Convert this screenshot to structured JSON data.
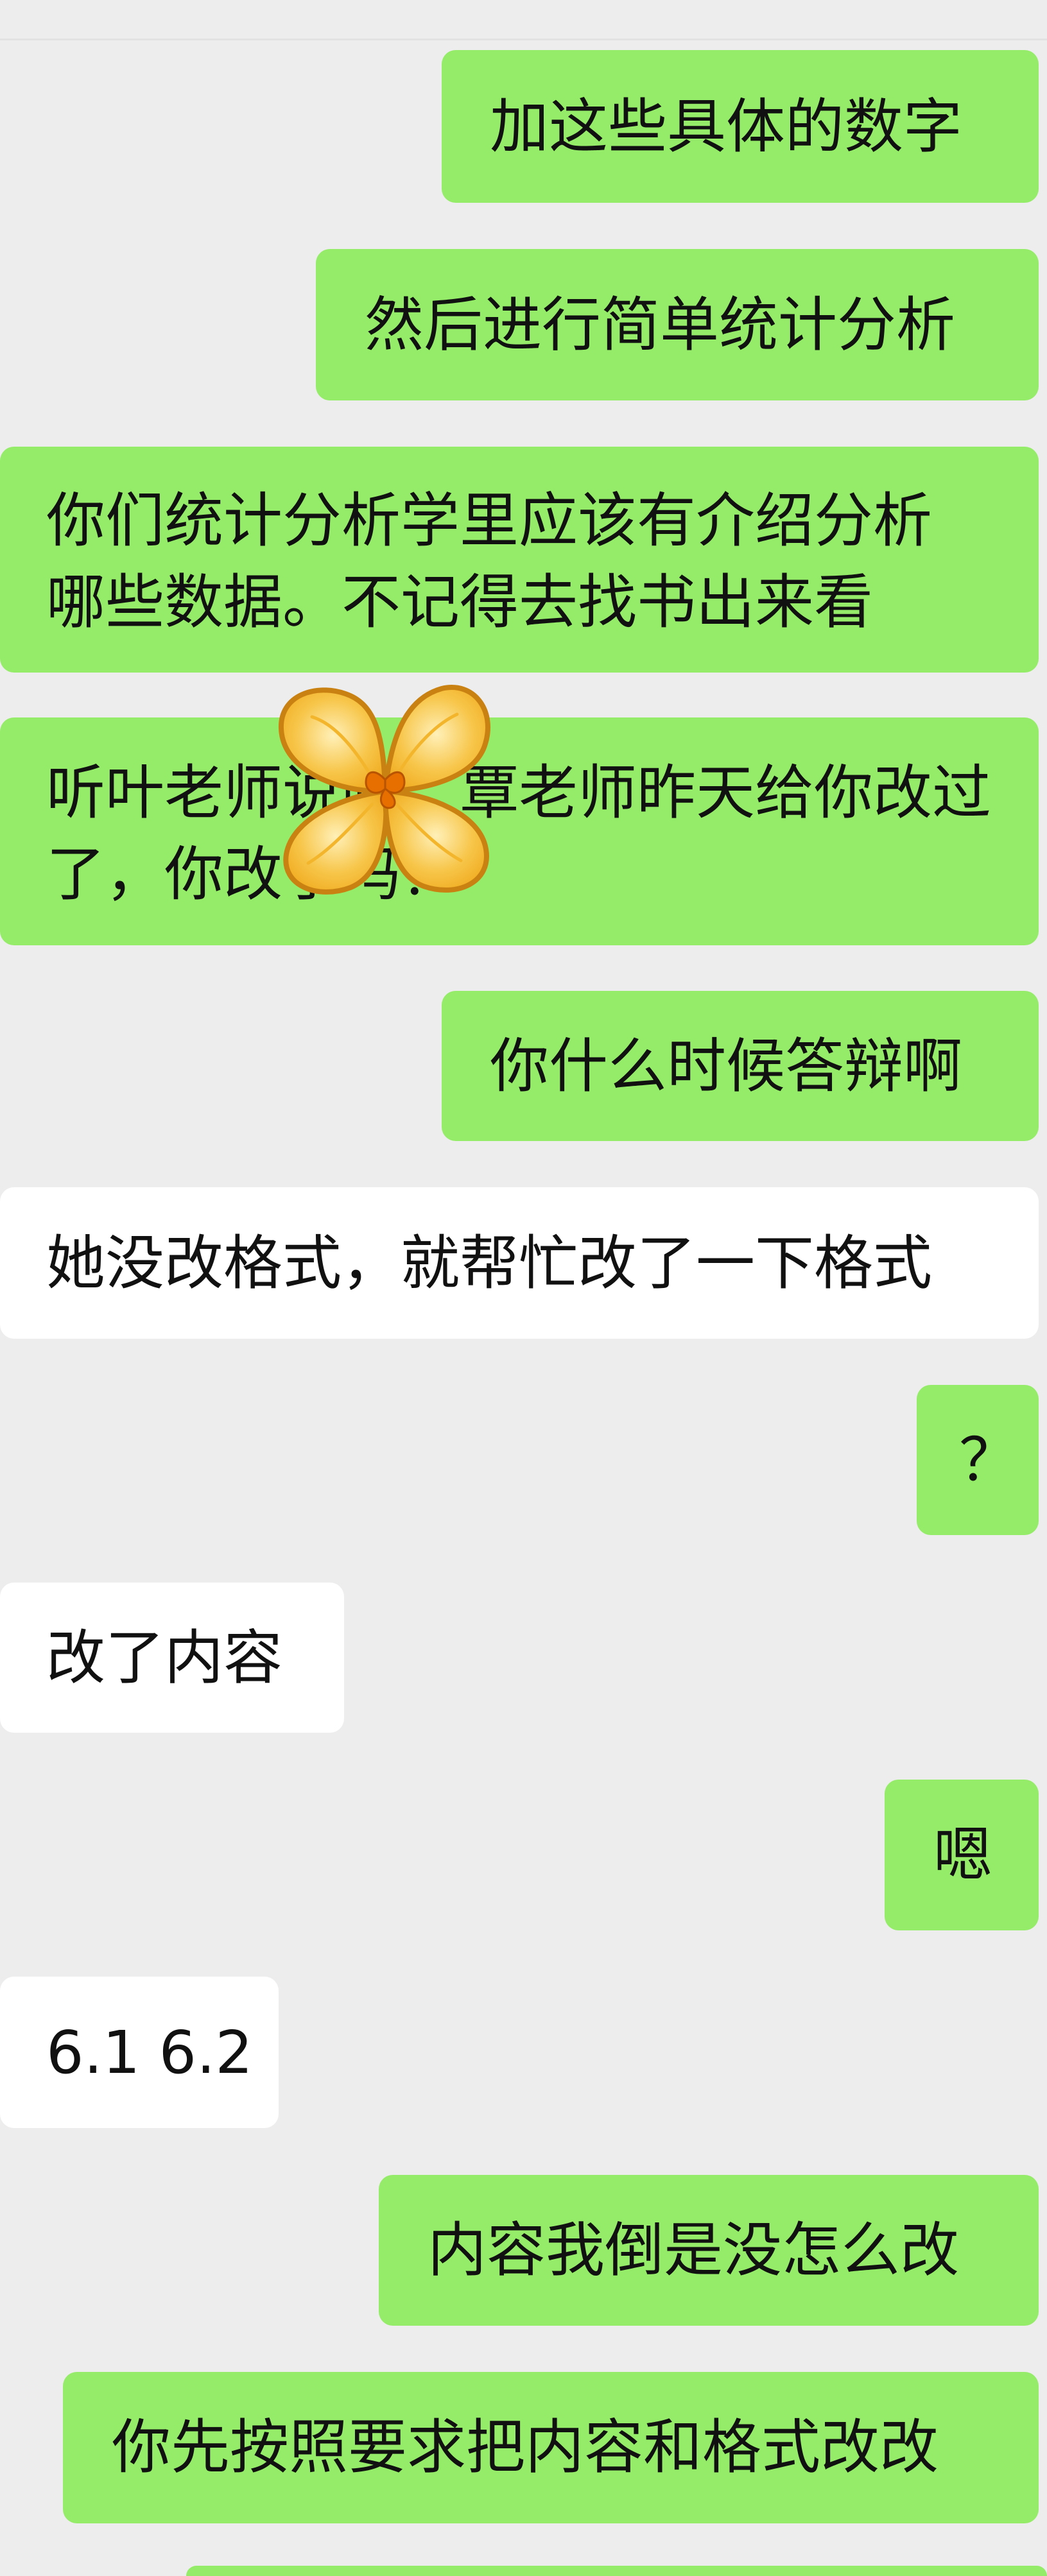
{
  "chat": {
    "messages": [
      {
        "side": "sent",
        "text": "加这些具体的数字"
      },
      {
        "side": "sent",
        "text": "然后进行简单统计分析"
      },
      {
        "side": "sent",
        "lines": [
          "你们统计分析学里应该有介绍分析",
          "哪些数据。不记得去找书出来看"
        ]
      },
      {
        "side": "sent",
        "lines": [
          "听叶老师说吗，覃老师昨天给你改过",
          "了，你改了吗？"
        ]
      },
      {
        "side": "sent",
        "text": "你什么时候答辩啊"
      },
      {
        "side": "received",
        "text": "她没改格式，就帮忙改了一下格式"
      },
      {
        "side": "sent",
        "text": "？"
      },
      {
        "side": "received",
        "text": "改了内容"
      },
      {
        "side": "sent",
        "text": "嗯"
      },
      {
        "side": "received",
        "text": "6.1 6.2"
      },
      {
        "side": "sent",
        "text": "内容我倒是没怎么改"
      },
      {
        "side": "sent",
        "text": "你先按照要求把内容和格式改改"
      }
    ]
  },
  "sticker": {
    "icon": "yellow-flower-sticker-icon",
    "colors": {
      "petal": "#f7c64a",
      "petal_light": "#fff0b8",
      "outline": "#c98212",
      "center": "#e66f00"
    }
  },
  "colors": {
    "background": "#ededed",
    "sent_bubble": "#95ec69",
    "received_bubble": "#ffffff",
    "text": "#111111"
  }
}
